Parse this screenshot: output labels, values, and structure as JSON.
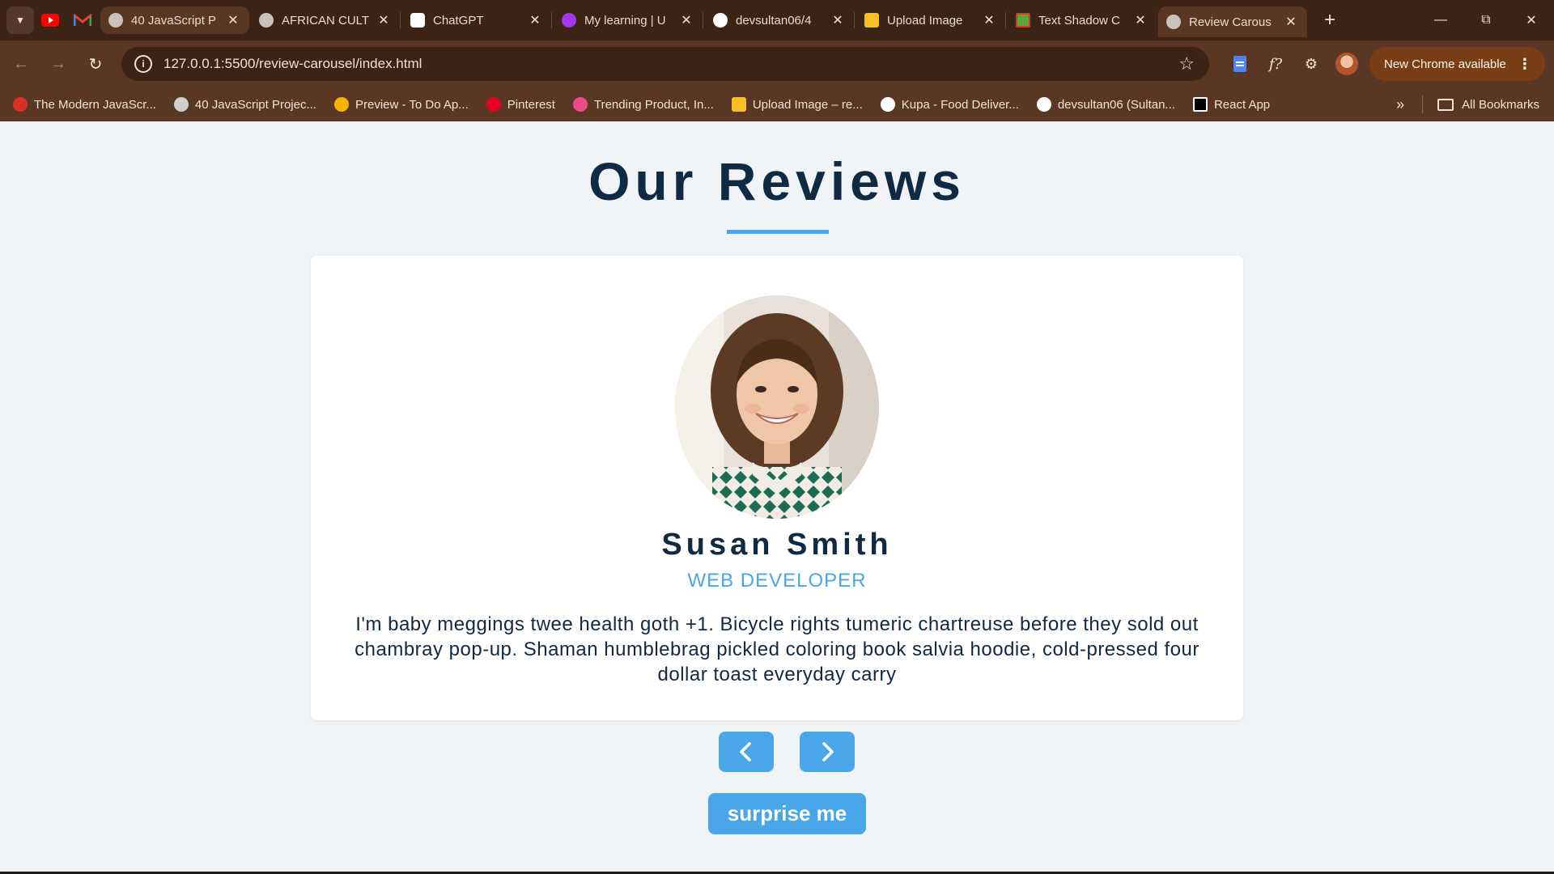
{
  "browser": {
    "tabs": [
      {
        "title": "40 JavaScript P",
        "icon": "globe-icon"
      },
      {
        "title": "AFRICAN CULT",
        "icon": "globe-icon"
      },
      {
        "title": "ChatGPT",
        "icon": "chatgpt-icon"
      },
      {
        "title": "My learning | U",
        "icon": "udemy-icon"
      },
      {
        "title": "devsultan06/4",
        "icon": "github-icon"
      },
      {
        "title": "Upload Image",
        "icon": "upload-icon"
      },
      {
        "title": "Text Shadow C",
        "icon": "text-shadow-icon"
      },
      {
        "title": "Review Carous",
        "icon": "globe-icon"
      }
    ],
    "url": "127.0.0.1:5500/review-carousel/index.html",
    "update_label": "New Chrome available",
    "bookmarks": [
      {
        "label": "The Modern JavaScr...",
        "color": "#d93025"
      },
      {
        "label": "40 JavaScript Projec...",
        "color": "#cfcfcf"
      },
      {
        "label": "Preview - To Do Ap...",
        "color": "#f4b400"
      },
      {
        "label": "Pinterest",
        "color": "#e60023"
      },
      {
        "label": "Trending Product, In...",
        "color": "#ea4c89"
      },
      {
        "label": "Upload Image – re...",
        "color": "#f6c026"
      },
      {
        "label": "Kupa - Food Deliver...",
        "color": "#ffffff"
      },
      {
        "label": "devsultan06 (Sultan...",
        "color": "#ffffff"
      },
      {
        "label": "React App",
        "color": "#000000"
      }
    ],
    "all_bookmarks_label": "All Bookmarks"
  },
  "page": {
    "title": "Our Reviews",
    "review": {
      "name": "Susan Smith",
      "job": "web developer",
      "text": "I'm baby meggings twee health goth +1. Bicycle rights tumeric chartreuse before they sold out chambray pop-up. Shaman humblebrag pickled coloring book salvia hoodie, cold-pressed four dollar toast everyday carry"
    },
    "surprise_label": "surprise me"
  },
  "colors": {
    "primary": "#49a6e9",
    "heading": "#102a43",
    "background": "#f0f4f7"
  }
}
